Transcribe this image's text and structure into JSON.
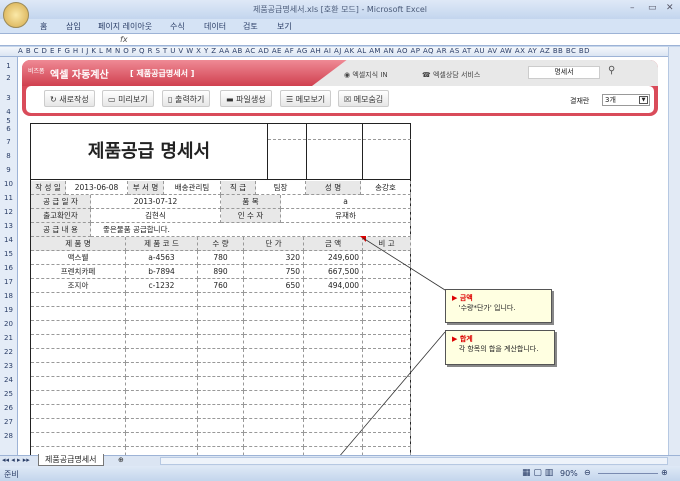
{
  "window": {
    "title": "제품공급명세서.xls [호환 모드] - Microsoft Excel",
    "min": "–",
    "max": "▭",
    "close": "✕"
  },
  "ribbon_tabs": [
    "홈",
    "삽입",
    "페이지 레이아웃",
    "수식",
    "데이터",
    "검토",
    "보기"
  ],
  "formula_bar": {
    "fx": "fx"
  },
  "columns": "A B C D E F G H I J K L M N O P Q R S T U V W X Y Z AA AB AC AD AE AF AG AH AI AJ AK AL AM AN AO AP AQ AR AS AT AU AV AW AX AY AZ BB BC BD",
  "rows": [
    "1",
    "2",
    "3",
    "4",
    "5",
    "6",
    "7",
    "8",
    "9",
    "10",
    "11",
    "12",
    "13",
    "14",
    "15",
    "16",
    "17",
    "18",
    "19",
    "20",
    "21",
    "22",
    "23",
    "24",
    "25",
    "26",
    "27",
    "28"
  ],
  "banner": {
    "brand": "비즈폼",
    "title": "엑셀 자동계산",
    "subtitle": "[ 제품공급명세서 ]",
    "link1": "엑셀지식 IN",
    "link2": "엑셀상담 서비스",
    "search_value": "명세서",
    "buttons": [
      "새로작성",
      "미리보기",
      "출력하기",
      "파일생성",
      "메모보기",
      "메모숨김"
    ],
    "approval_label": "결재란",
    "approval_value": "3개"
  },
  "form": {
    "title": "제품공급 명세서",
    "r10": [
      "작 성 일",
      "2013-06-08",
      "부 서 명",
      "배송관리팀",
      "직 급",
      "팀장",
      "성 명",
      "송강호"
    ],
    "r11": [
      "공 급 일 자",
      "2013-07-12",
      "품 목",
      "a"
    ],
    "r12": [
      "출고확인자",
      "김현식",
      "인 수 자",
      "유재하"
    ],
    "r13": [
      "공 급 내 용",
      "좋은물품 공급합니다."
    ],
    "headers": [
      "제 품 명",
      "제 품 코 드",
      "수 량",
      "단 가",
      "금 액",
      "비 고"
    ],
    "items": [
      [
        "맥스웰",
        "a-4563",
        "780",
        "320",
        "249,600",
        ""
      ],
      [
        "프렌치카페",
        "b-7894",
        "890",
        "750",
        "667,500",
        ""
      ],
      [
        "조지아",
        "c-1232",
        "760",
        "650",
        "494,000",
        ""
      ]
    ]
  },
  "comments": [
    {
      "title": "금액",
      "text": "'수량*단가' 입니다."
    },
    {
      "title": "합계",
      "text": "각 항목의 합을 계산합니다."
    }
  ],
  "sheet_tab": "제품공급명세서",
  "status": {
    "ready": "준비",
    "zoom": "90%"
  }
}
